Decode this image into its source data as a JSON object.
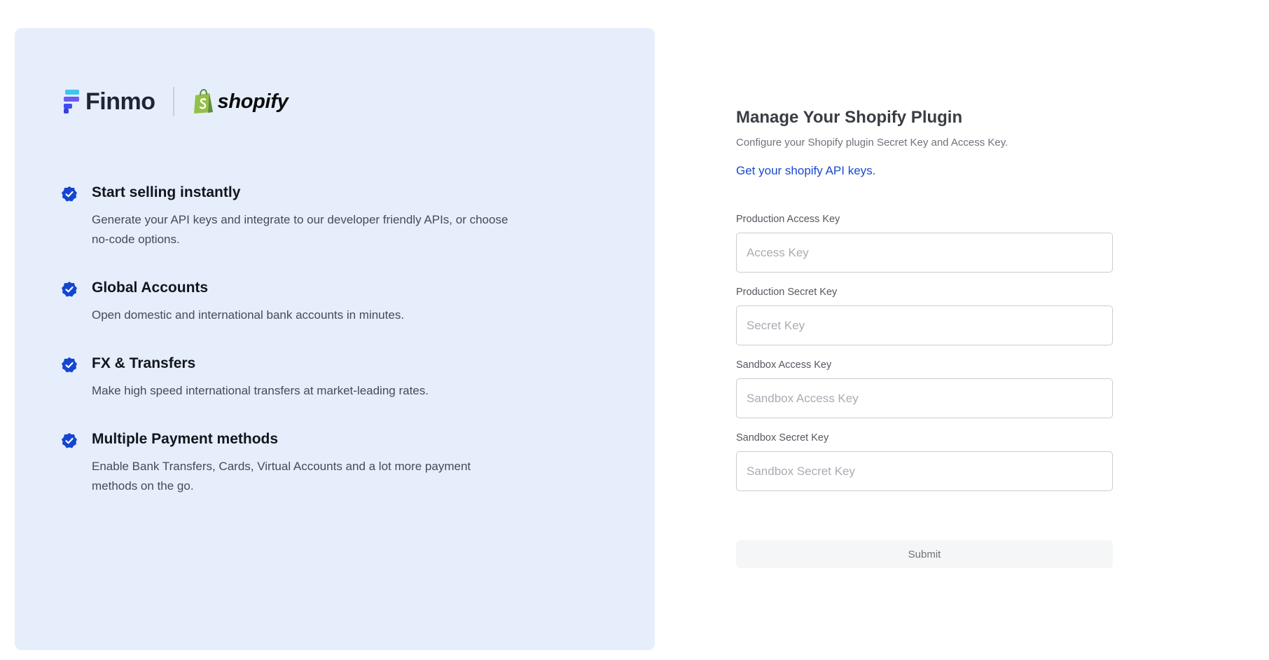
{
  "brand": {
    "finmo_name": "Finmo",
    "shopify_name": "shopify"
  },
  "features": [
    {
      "title": "Start selling instantly",
      "description": "Generate your API keys and integrate to our developer friendly APIs, or choose no-code options."
    },
    {
      "title": "Global Accounts",
      "description": "Open domestic and international bank accounts in minutes."
    },
    {
      "title": "FX & Transfers",
      "description": "Make high speed international transfers at market-leading rates."
    },
    {
      "title": "Multiple Payment methods",
      "description": "Enable Bank Transfers, Cards, Virtual Accounts and a lot more payment methods on the go."
    }
  ],
  "form": {
    "title": "Manage Your Shopify Plugin",
    "subtitle": "Configure your Shopify plugin Secret Key and Access Key.",
    "link_label": "Get your shopify API keys.",
    "fields": [
      {
        "label": "Production Access Key",
        "placeholder": "Access Key",
        "value": ""
      },
      {
        "label": "Production Secret Key",
        "placeholder": "Secret Key",
        "value": ""
      },
      {
        "label": "Sandbox Access Key",
        "placeholder": "Sandbox Access Key",
        "value": ""
      },
      {
        "label": "Sandbox Secret Key",
        "placeholder": "Sandbox Secret Key",
        "value": ""
      }
    ],
    "submit_label": "Submit"
  },
  "colors": {
    "panel_background": "#e6eefc",
    "accent_blue": "#1a49d0",
    "check_badge": "#1446d1",
    "shopify_green": "#95bf47"
  },
  "icons": {
    "feature_check": "check-badge-icon",
    "finmo_logo": "finmo-logo-icon",
    "shopify_logo": "shopify-bag-icon"
  }
}
